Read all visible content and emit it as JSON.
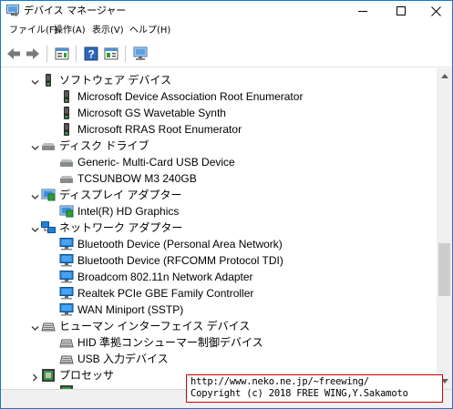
{
  "window": {
    "title": "デバイス マネージャー"
  },
  "menu": {
    "file": "ファイル(F)",
    "action": "操作(A)",
    "view": "表示(V)",
    "help": "ヘルプ(H)"
  },
  "toolbar": {
    "icons": [
      "back-arrow-icon",
      "forward-arrow-icon",
      "properties-icon",
      "help-icon",
      "device-list-icon",
      "scan-hardware-icon"
    ]
  },
  "tree": {
    "categories": {
      "software_devices": {
        "label": "ソフトウェア デバイス",
        "items": [
          "Microsoft Device Association Root Enumerator",
          "Microsoft GS Wavetable Synth",
          "Microsoft RRAS Root Enumerator"
        ]
      },
      "disk_drives": {
        "label": "ディスク ドライブ",
        "items": [
          "Generic- Multi-Card USB Device",
          "TCSUNBOW M3 240GB"
        ]
      },
      "display_adapters": {
        "label": "ディスプレイ アダプター",
        "items": [
          "Intel(R) HD Graphics"
        ]
      },
      "network_adapters": {
        "label": "ネットワーク アダプター",
        "items": [
          "Bluetooth Device (Personal Area Network)",
          "Bluetooth Device (RFCOMM Protocol TDI)",
          "Broadcom 802.11n Network Adapter",
          "Realtek PCIe GBE Family Controller",
          "WAN Miniport (SSTP)"
        ]
      },
      "hid": {
        "label": "ヒューマン インターフェイス デバイス",
        "items": [
          "HID 準拠コンシューマー制御デバイス",
          "USB 入力デバイス"
        ]
      },
      "processors": {
        "label": "プロセッサ"
      }
    }
  },
  "watermark": {
    "line1": "http://www.neko.ne.jp/~freewing/",
    "line2": "Copyright (c) 2018 FREE WING,Y.Sakamoto"
  },
  "colors": {
    "window_border": "#1979ca",
    "watermark_border": "#cc0000",
    "network_icon": "#1d82d8"
  }
}
